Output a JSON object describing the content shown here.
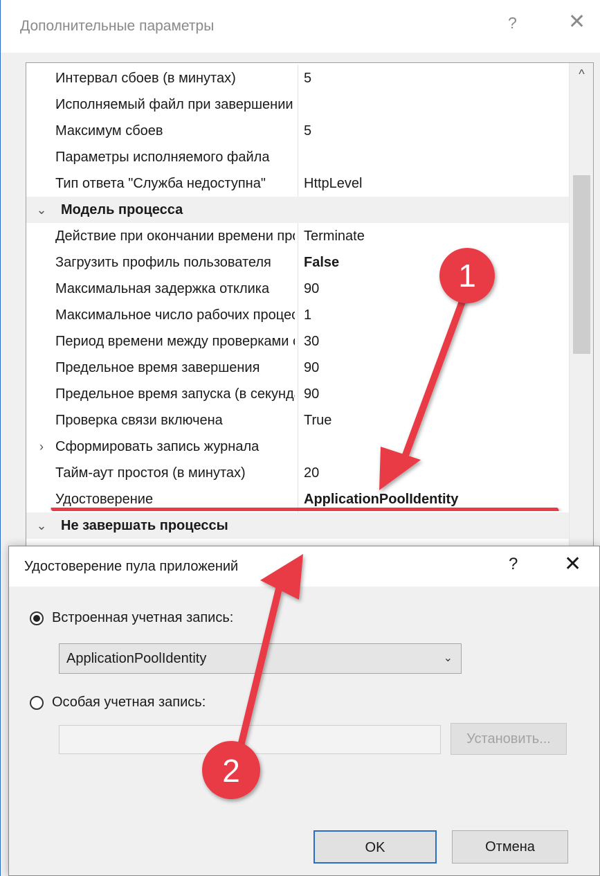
{
  "back_dialog": {
    "title": "Дополнительные параметры",
    "help": "?",
    "close": "✕",
    "rows": [
      {
        "type": "prop",
        "name": "Интервал сбоев (в минутах)",
        "value": "5"
      },
      {
        "type": "prop",
        "name": "Исполняемый файл при завершении сбоя",
        "value": ""
      },
      {
        "type": "prop",
        "name": "Максимум сбоев",
        "value": "5"
      },
      {
        "type": "prop",
        "name": "Параметры исполняемого файла",
        "value": ""
      },
      {
        "type": "prop",
        "name": "Тип ответа \"Служба недоступна\"",
        "value": "HttpLevel"
      },
      {
        "type": "category",
        "name": "Модель процесса",
        "chevron": "⌄"
      },
      {
        "type": "prop",
        "name": "Действие при окончании времени простоя",
        "value": "Terminate"
      },
      {
        "type": "prop",
        "name": "Загрузить профиль пользователя",
        "value": "False",
        "bold": true
      },
      {
        "type": "prop",
        "name": "Максимальная задержка отклика",
        "value": "90"
      },
      {
        "type": "prop",
        "name": "Максимальное число рабочих процессов",
        "value": "1"
      },
      {
        "type": "prop",
        "name": "Период времени между проверками связи",
        "value": "30"
      },
      {
        "type": "prop",
        "name": "Предельное время завершения",
        "value": "90"
      },
      {
        "type": "prop",
        "name": "Предельное время запуска (в секундах)",
        "value": "90"
      },
      {
        "type": "prop",
        "name": "Проверка связи включена",
        "value": "True"
      },
      {
        "type": "prop",
        "name": "Сформировать запись журнала",
        "value": "",
        "chevron": "›"
      },
      {
        "type": "prop",
        "name": "Тайм-аут простоя (в минутах)",
        "value": "20"
      },
      {
        "type": "prop",
        "name": "Удостоверение",
        "value": "ApplicationPoolIdentity",
        "bold": true
      },
      {
        "type": "category",
        "name": "Не завершать процессы",
        "chevron": "⌄"
      }
    ]
  },
  "front_dialog": {
    "title": "Удостоверение пула приложений",
    "help": "?",
    "close": "✕",
    "builtin_label": "Встроенная учетная запись:",
    "builtin_value": "ApplicationPoolIdentity",
    "custom_label": "Особая учетная запись:",
    "custom_value": "",
    "set_button": "Установить...",
    "ok_button": "OK",
    "cancel_button": "Отмена"
  },
  "annotations": [
    {
      "label": "1"
    },
    {
      "label": "2"
    }
  ],
  "colors": {
    "annotation_red": "#e83a45",
    "window_border": "#2b6cc4",
    "dialog_bg": "#f0f0f0"
  }
}
